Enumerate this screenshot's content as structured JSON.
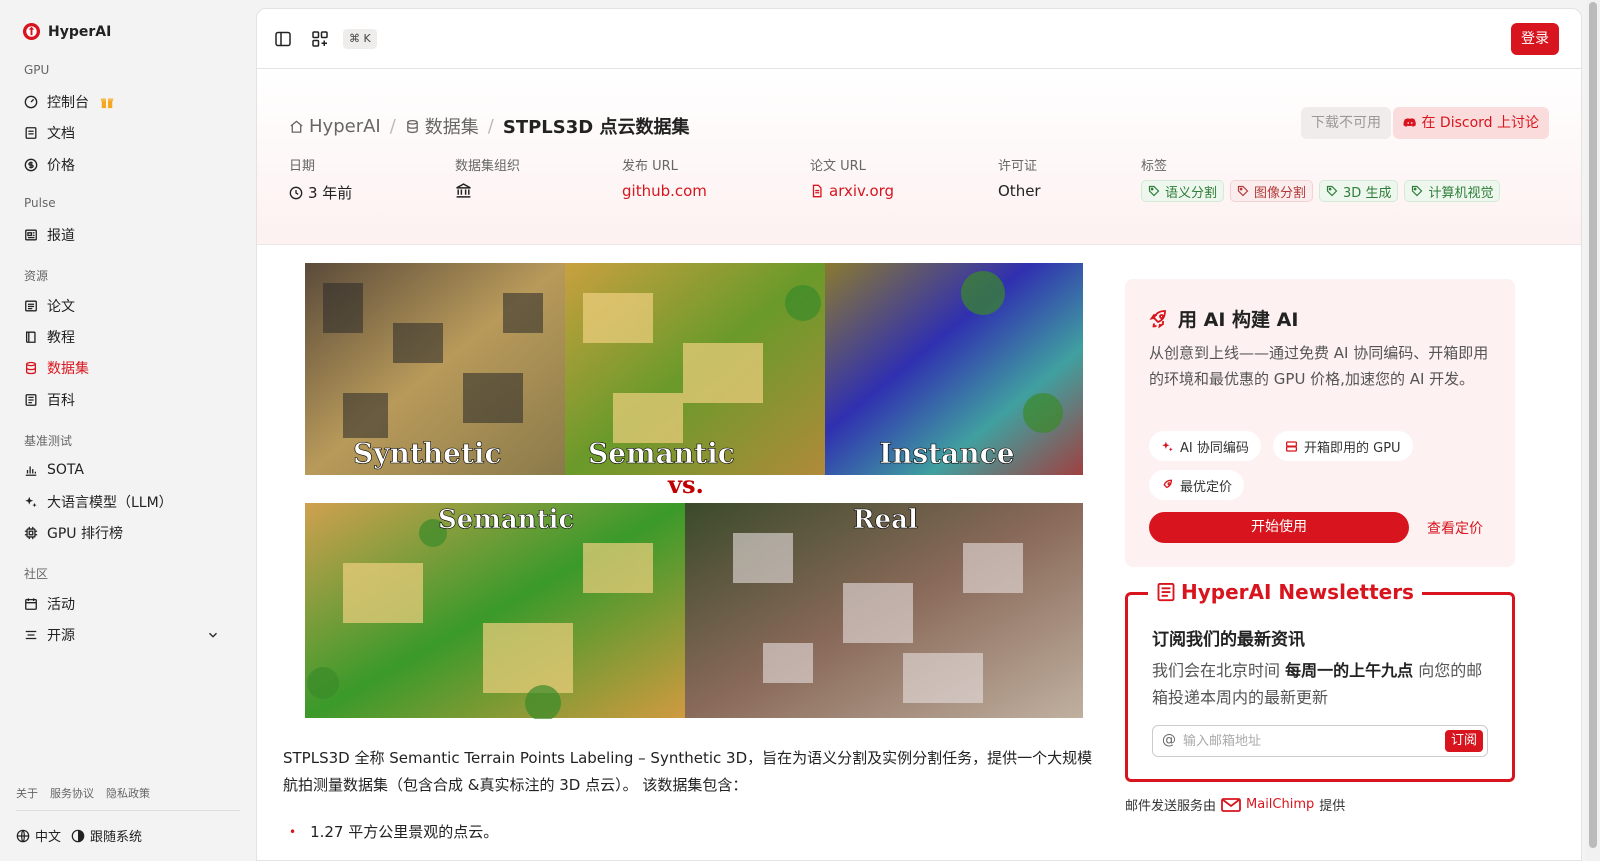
{
  "brand": {
    "name": "HyperAI"
  },
  "sidebar": {
    "sections": [
      {
        "label": "GPU",
        "items": [
          {
            "label": "控制台",
            "icon": "gauge-icon"
          },
          {
            "label": "文档",
            "icon": "doc-icon"
          },
          {
            "label": "价格",
            "icon": "dollar-icon"
          }
        ]
      },
      {
        "label": "Pulse",
        "items": [
          {
            "label": "报道",
            "icon": "newspaper-icon"
          }
        ]
      },
      {
        "label": "资源",
        "items": [
          {
            "label": "论文",
            "icon": "paper-icon"
          },
          {
            "label": "教程",
            "icon": "book-icon"
          },
          {
            "label": "数据集",
            "icon": "database-icon",
            "active": true
          },
          {
            "label": "百科",
            "icon": "book-icon"
          }
        ]
      },
      {
        "label": "基准测试",
        "items": [
          {
            "label": "SOTA",
            "icon": "chart-icon"
          },
          {
            "label": "大语言模型（LLM）",
            "icon": "sparkle-icon"
          },
          {
            "label": "GPU 排行榜",
            "icon": "cpu-icon"
          }
        ]
      },
      {
        "label": "社区",
        "items": [
          {
            "label": "活动",
            "icon": "calendar-icon"
          },
          {
            "label": "开源",
            "icon": "list-icon"
          }
        ]
      }
    ],
    "footer_links": [
      "关于",
      "服务协议",
      "隐私政策"
    ],
    "language": "中文",
    "theme": "跟随系统"
  },
  "topbar": {
    "shortcut": "⌘ K",
    "login": "登录"
  },
  "breadcrumb": {
    "home": "HyperAI",
    "section": "数据集",
    "current": "STPLS3D 点云数据集"
  },
  "actions": {
    "download": "下载不可用",
    "discord": "在 Discord 上讨论"
  },
  "meta": {
    "date_label": "日期",
    "date_value": "3 年前",
    "org_label": "数据集组织",
    "url_label": "发布 URL",
    "url_value": "github.com",
    "paper_label": "论文 URL",
    "paper_value": "arxiv.org",
    "license_label": "许可证",
    "license_value": "Other",
    "tags_label": "标签",
    "tags": [
      "语义分割",
      "图像分割",
      "3D 生成",
      "计算机视觉"
    ]
  },
  "image": {
    "labels": {
      "synthetic": "Synthetic",
      "semantic_top": "Semantic",
      "instance": "Instance",
      "vs": "vs.",
      "semantic_bottom": "Semantic",
      "real": "Real"
    }
  },
  "description": {
    "text": "STPLS3D 全称 Semantic Terrain Points Labeling – Synthetic 3D，旨在为语义分割及实例分割任务，提供一个大规模航拍测量数据集（包含合成 &真实标注的 3D 点云）。 该数据集包含：",
    "bullet": "1.27 平方公里景观的点云。"
  },
  "promo": {
    "title": "用 AI 构建 AI",
    "text": "从创意到上线——通过免费 AI 协同编码、开箱即用的环境和最优惠的 GPU 价格,加速您的 AI 开发。",
    "pills": [
      "AI 协同编码",
      "开箱即用的 GPU",
      "最优定价"
    ],
    "start": "开始使用",
    "pricing": "查看定价"
  },
  "newsletter": {
    "legend": "HyperAI Newsletters",
    "heading": "订阅我们的最新资讯",
    "text_before": "我们会在北京时间 ",
    "text_bold": "每周一的上午九点",
    "text_after": " 向您的邮箱投递本周内的最新更新",
    "placeholder": "输入邮箱地址",
    "subscribe": "订阅",
    "by_prefix": "邮件发送服务由",
    "by_name": "MailChimp",
    "by_suffix": "提供"
  },
  "colors": {
    "accent": "#d8151e",
    "sidebar_bg": "#f4f3f3",
    "hero_bg": "#fdf1f1"
  }
}
